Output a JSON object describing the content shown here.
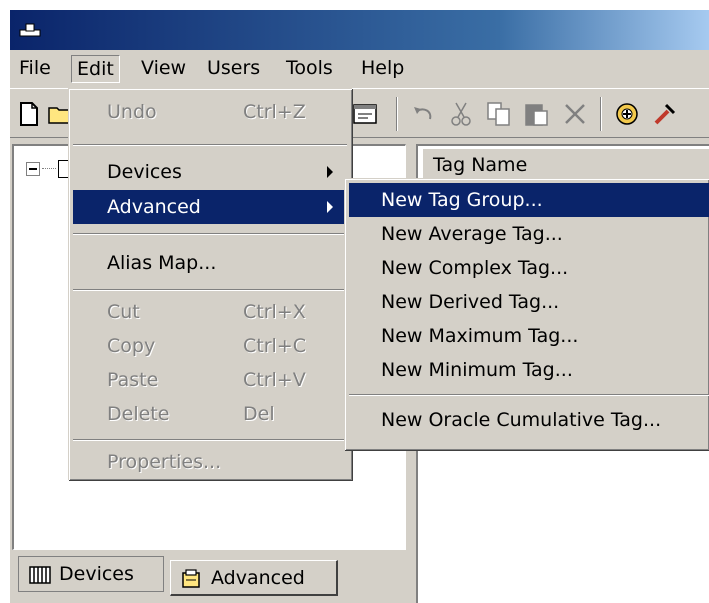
{
  "menubar": {
    "items": [
      "File",
      "Edit",
      "View",
      "Users",
      "Tools",
      "Help"
    ]
  },
  "toolbar": {
    "icons": [
      "new-icon",
      "open-icon",
      "properties-icon",
      "undo-icon",
      "cut-icon",
      "copy-icon",
      "paste-icon",
      "delete-icon",
      "add-tag-icon",
      "tools-icon"
    ]
  },
  "edit_menu": {
    "undo": {
      "label": "Undo",
      "shortcut": "Ctrl+Z"
    },
    "devices": "Devices",
    "advanced": "Advanced",
    "alias_map": "Alias Map...",
    "cut": {
      "label": "Cut",
      "shortcut": "Ctrl+X"
    },
    "copy": {
      "label": "Copy",
      "shortcut": "Ctrl+C"
    },
    "paste": {
      "label": "Paste",
      "shortcut": "Ctrl+V"
    },
    "delete": {
      "label": "Delete",
      "shortcut": "Del"
    },
    "properties": "Properties..."
  },
  "advanced_menu": {
    "items": [
      "New Tag Group...",
      "New Average Tag...",
      "New Complex Tag...",
      "New Derived Tag...",
      "New Maximum Tag...",
      "New Minimum Tag...",
      "New Oracle Cumulative Tag..."
    ]
  },
  "tag_list": {
    "column_header": "Tag Name"
  },
  "tabs": [
    "Devices",
    "Advanced"
  ],
  "colors": {
    "selection": "#0a246a",
    "face": "#d4d0c8"
  }
}
